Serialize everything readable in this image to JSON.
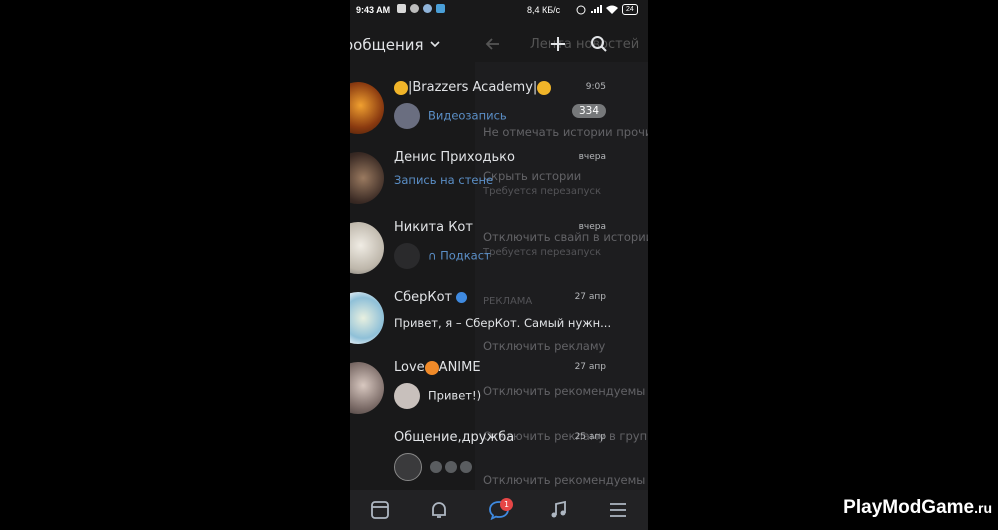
{
  "status_bar": {
    "time": "9:43 AM",
    "network_speed": "8,4 КБ/с",
    "battery": "24"
  },
  "header": {
    "title": "ообщения",
    "feed_ghost": "Лента новостей"
  },
  "ghost_menu": [
    "Не отмечать истории прочи",
    "Скрыть истории",
    "Требуется перезапуск",
    "Отключить свайп в истории",
    "Требуется перезапуск",
    "РЕКЛАМА",
    "Отключить рекламу",
    "Отключить рекомендуемы",
    "Отключить рекламу в груп",
    "Отключить рекомендуемы"
  ],
  "chats": [
    {
      "title": "|Brazzers Academy|",
      "time": "9:05",
      "subtitle": "Видеозапись",
      "badge": "334"
    },
    {
      "title": "Денис Приходько",
      "time": "вчера",
      "subtitle": "Запись на стене"
    },
    {
      "title": "Никита Кот",
      "time": "вчера",
      "subtitle": "Подкаст"
    },
    {
      "title": "СберКот",
      "time": "27 апр",
      "subtitle": "Привет, я – СберКот. Самый нужн..."
    },
    {
      "title": "ANIME",
      "title_prefix": "Love",
      "time": "27 апр",
      "subtitle": "Привет!)"
    },
    {
      "title": "Общение,дружба",
      "time": "25 апр",
      "subtitle": ""
    }
  ],
  "tabbar": {
    "messages_badge": "1"
  },
  "watermark": {
    "main": "PlayModGame",
    "suffix": ".ru"
  },
  "colors": {
    "background": "#19191a",
    "accent_blue": "#5b8fc7",
    "badge_red": "#e64646"
  }
}
